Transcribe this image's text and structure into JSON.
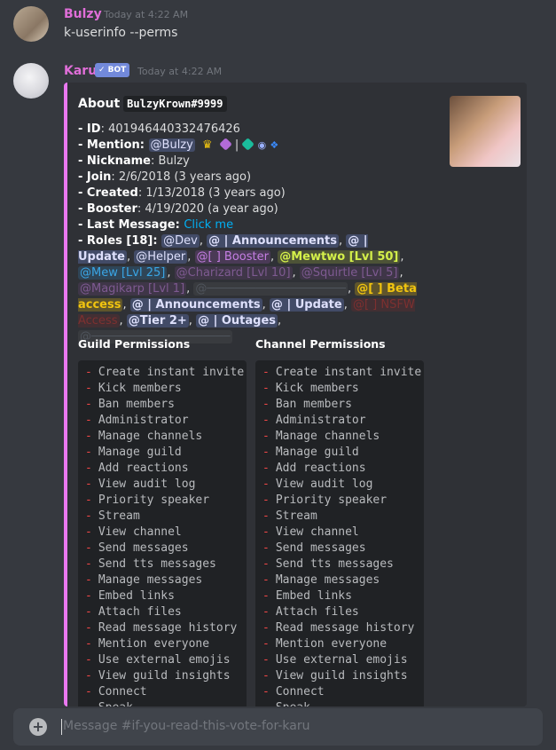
{
  "messages": [
    {
      "author": "Bulzy",
      "author_color": "#e06ed8",
      "timestamp": "Today at 4:22 AM",
      "content": "k-userinfo --perms"
    },
    {
      "author": "Karu",
      "author_color": "#e06ed8",
      "bot_badge": "✓ BOT",
      "timestamp": "Today at 4:22 AM"
    }
  ],
  "embed": {
    "accent_color": "#ea78f0",
    "title_prefix": "About",
    "title_code": "BulzyKrown#9999",
    "fields": {
      "id_label": "- ID",
      "id_value": ": 401946440332476426",
      "mention_label": "- Mention",
      "mention_value": "@Bulzy",
      "nickname_label": "- Nickname",
      "nickname_value": ": Bulzy",
      "join_label": "- Join",
      "join_value": ": 2/6/2018 (3 years ago)",
      "created_label": "- Created",
      "created_value": ": 1/13/2018 (3 years ago)",
      "booster_label": "- Booster",
      "booster_value": ": 4/19/2020 (a year ago)",
      "last_message_label": "- Last Message",
      "last_message_value": "Click me",
      "roles_label": "- Roles [18]",
      "roles": [
        "@Dev",
        "@ | Announcements",
        "@ | Update",
        "@Helper",
        "@[ ] Booster",
        "@Mewtwo [Lvl 50]",
        "@Mew [Lvl 25]",
        "@Charizard [Lvl 10]",
        "@Squirtle [Lvl 5]",
        "@Magikarp [Lvl 1]",
        "@────────────────────",
        "@[ ] Beta access",
        "@ | Announcements",
        "@ | Update",
        "@[ ] NSFW Access",
        "@Tier 2+",
        "@ | Outages",
        "@────────────────────"
      ]
    },
    "guild_permissions_title": "Guild Permissions",
    "channel_permissions_title": "Channel Permissions",
    "permissions": [
      "Create instant invite",
      "Kick members",
      "Ban members",
      "Administrator",
      "Manage channels",
      "Manage guild",
      "Add reactions",
      "View audit log",
      "Priority speaker",
      "Stream",
      "View channel",
      "Send messages",
      "Send tts messages",
      "Manage messages",
      "Embed links",
      "Attach files",
      "Read message history",
      "Mention everyone",
      "Use external emojis",
      "View guild insights",
      "Connect",
      "Speak"
    ]
  },
  "composer": {
    "placeholder": "Message #if-you-read-this-vote-for-karu",
    "plus_icon": "plus-circle-icon"
  }
}
